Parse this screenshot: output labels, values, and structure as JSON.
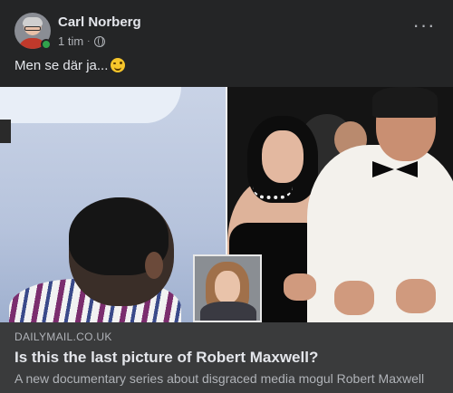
{
  "post": {
    "author": "Carl Norberg",
    "time": "1 tim",
    "separator": "·",
    "privacy_icon": "globe-icon",
    "more_icon": "more-options-icon",
    "more_label": "···",
    "text": "Men se där ja...",
    "emoji": "wink-emoji-icon"
  },
  "link": {
    "domain": "DAILYMAIL.CO.UK",
    "title": "Is this the last picture of Robert Maxwell?",
    "description": "A new documentary series about disgraced media mogul Robert Maxwell"
  },
  "colors": {
    "card_bg": "#242526",
    "link_bg": "#3a3b3c",
    "primary_text": "#e4e6eb",
    "secondary_text": "#b0b3b8",
    "online": "#31a24c"
  }
}
